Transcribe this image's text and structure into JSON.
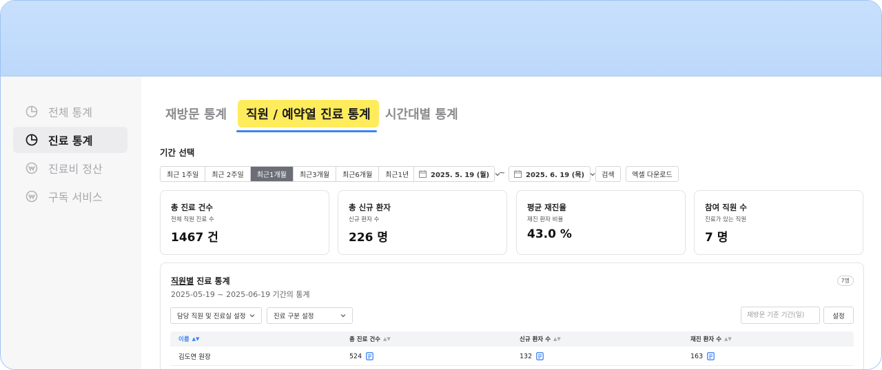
{
  "sidebar": {
    "items": [
      {
        "label": "전체 통계",
        "icon": "pie-chart-icon",
        "active": false
      },
      {
        "label": "진료 통계",
        "icon": "pie-chart-icon",
        "active": true
      },
      {
        "label": "진료비 정산",
        "icon": "won-icon",
        "active": false
      },
      {
        "label": "구독 서비스",
        "icon": "won-icon",
        "active": false
      }
    ]
  },
  "tabs": [
    {
      "label": "재방문 통계"
    },
    {
      "label": "직원 / 예약열 진료 통계"
    },
    {
      "label": "시간대별 통계"
    }
  ],
  "period": {
    "label": "기간 선택",
    "options": [
      "최근 1주일",
      "최근 2주일",
      "최근1개월",
      "최근3개월",
      "최근6개월",
      "최근1년"
    ],
    "selected": "최근1개월",
    "start_date": "2025. 5. 19 (월)",
    "end_date": "2025. 6. 19 (목)",
    "separator": "~",
    "search_label": "검색",
    "excel_label": "엑셀 다운로드"
  },
  "cards": [
    {
      "title": "총 진료 건수",
      "subtitle": "전체 직원 진료 수",
      "value": "1467 건"
    },
    {
      "title": "총 신규 환자",
      "subtitle": "신규 환자 수",
      "value": "226 명"
    },
    {
      "title": "평균 재진율",
      "subtitle": "재진 환자 비율",
      "value": "43.0 %"
    },
    {
      "title": "참여 직원 수",
      "subtitle": "진료가 있는 직원",
      "value": "7 명"
    }
  ],
  "panel": {
    "title_underlined": "직원별",
    "title_rest": " 진료 통계",
    "subtitle": "2025-05-19 ~ 2025-06-19 기간의 통계",
    "badge": "7명",
    "filter1": "담당 직원 및 진료실 설정",
    "filter2": "진료 구분 설정",
    "period_placeholder": "재방문 기준 기간(일)",
    "set_label": "설정",
    "columns": [
      "이름",
      "총 진료 건수",
      "신규 환자 수",
      "재진 환자 수"
    ],
    "rows": [
      {
        "name": "김도연 원장",
        "total": "524",
        "new": "132",
        "returning": "163"
      }
    ]
  },
  "colors": {
    "banner": "#c8e0fc",
    "accent_blue": "#3b82f6",
    "tab_highlight": "#ffec5c",
    "selected_segment": "#6b6e75"
  }
}
